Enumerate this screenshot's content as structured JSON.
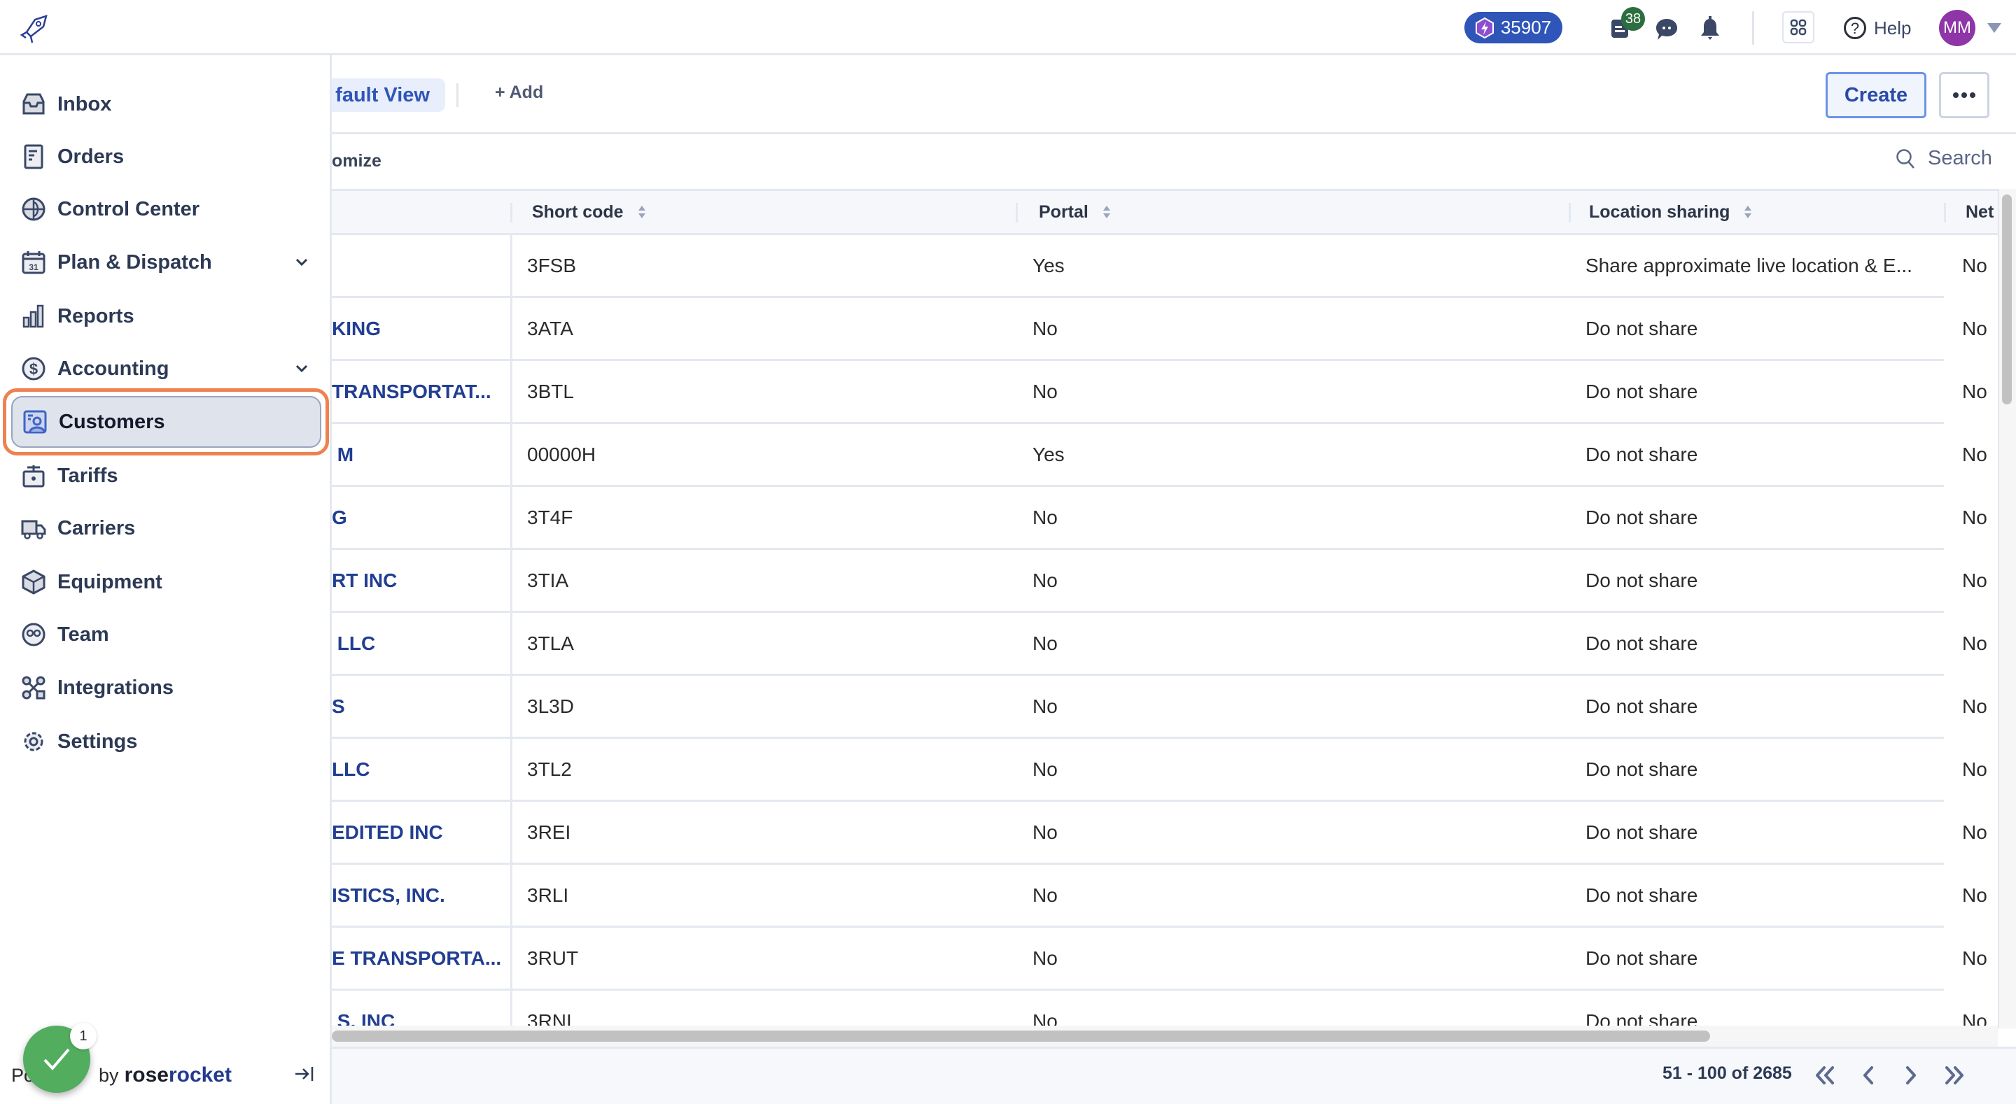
{
  "topbar": {
    "points": "35907",
    "notes_count": "38",
    "help_label": "Help",
    "avatar_initials": "MM"
  },
  "sidebar": {
    "items": [
      {
        "label": "Inbox",
        "icon": "inbox-icon"
      },
      {
        "label": "Orders",
        "icon": "orders-icon"
      },
      {
        "label": "Control Center",
        "icon": "globe-icon"
      },
      {
        "label": "Plan & Dispatch",
        "icon": "calendar-icon",
        "expandable": true
      },
      {
        "label": "Reports",
        "icon": "bar-chart-icon"
      },
      {
        "label": "Accounting",
        "icon": "dollar-icon",
        "expandable": true
      },
      {
        "label": "Customers",
        "icon": "customers-icon",
        "active": true
      },
      {
        "label": "Tariffs",
        "icon": "tariff-icon"
      },
      {
        "label": "Carriers",
        "icon": "truck-icon"
      },
      {
        "label": "Equipment",
        "icon": "box-icon"
      },
      {
        "label": "Team",
        "icon": "team-icon"
      },
      {
        "label": "Integrations",
        "icon": "integrations-icon"
      },
      {
        "label": "Settings",
        "icon": "gear-icon"
      }
    ],
    "powered_by": "Po",
    "powered_by_rest": "by",
    "brand_rose": "rose",
    "brand_rocket": "rocket",
    "toast_count": "1"
  },
  "toolbar": {
    "view_tab": "fault View",
    "add_label": "+ Add",
    "create_label": "Create",
    "customize_label": "omize",
    "search_placeholder": "Search"
  },
  "table": {
    "columns": [
      "Short code",
      "Portal",
      "Location sharing",
      "Net"
    ],
    "rows": [
      {
        "name": "",
        "code": "3FSB",
        "portal": "Yes",
        "location": "Share approximate live location & E...",
        "net": "No"
      },
      {
        "name": "KING",
        "code": "3ATA",
        "portal": "No",
        "location": "Do not share",
        "net": "No"
      },
      {
        "name": "TRANSPORTAT...",
        "code": "3BTL",
        "portal": "No",
        "location": "Do not share",
        "net": "No"
      },
      {
        "name": " M",
        "code": "00000H",
        "portal": "Yes",
        "location": "Do not share",
        "net": "No"
      },
      {
        "name": "G",
        "code": "3T4F",
        "portal": "No",
        "location": "Do not share",
        "net": "No"
      },
      {
        "name": "RT INC",
        "code": "3TIA",
        "portal": "No",
        "location": "Do not share",
        "net": "No"
      },
      {
        "name": " LLC",
        "code": "3TLA",
        "portal": "No",
        "location": "Do not share",
        "net": "No"
      },
      {
        "name": "S",
        "code": "3L3D",
        "portal": "No",
        "location": "Do not share",
        "net": "No"
      },
      {
        "name": "LLC",
        "code": "3TL2",
        "portal": "No",
        "location": "Do not share",
        "net": "No"
      },
      {
        "name": "EDITED INC",
        "code": "3REI",
        "portal": "No",
        "location": "Do not share",
        "net": "No"
      },
      {
        "name": "ISTICS, INC.",
        "code": "3RLI",
        "portal": "No",
        "location": "Do not share",
        "net": "No"
      },
      {
        "name": "E TRANSPORTA...",
        "code": "3RUT",
        "portal": "No",
        "location": "Do not share",
        "net": "No"
      },
      {
        "name": " S, INC",
        "code": "3RNI",
        "portal": "No",
        "location": "Do not share",
        "net": "No"
      }
    ]
  },
  "pagination": {
    "range": "51 - 100 of 2685"
  },
  "colors": {
    "accent": "#2f55b8",
    "link": "#213e91",
    "highlight": "#ee8150",
    "toast": "#52ad5f"
  }
}
